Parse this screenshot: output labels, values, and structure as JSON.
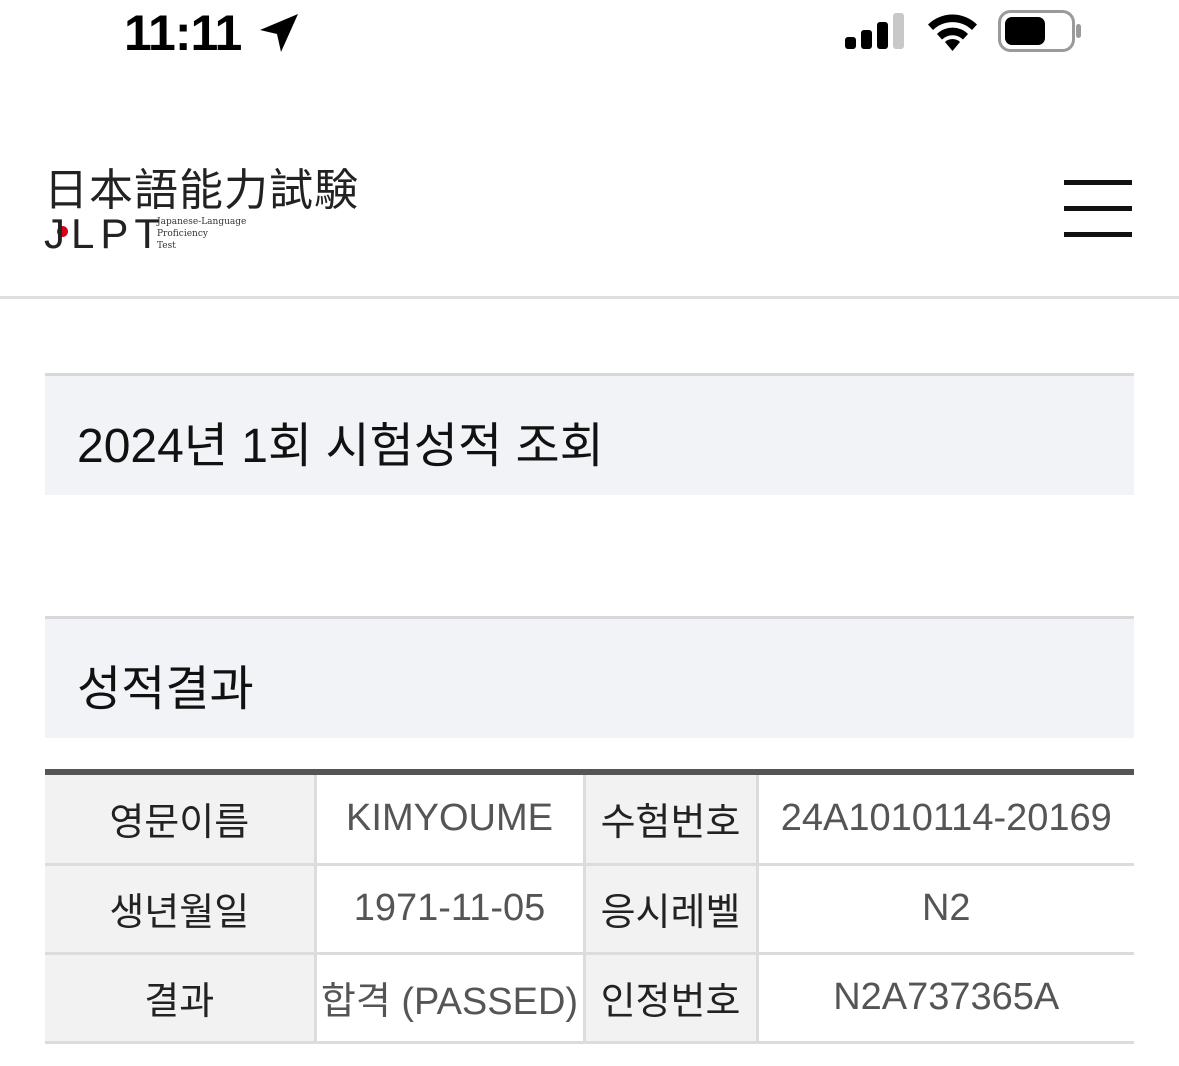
{
  "status_bar": {
    "time": "11:11",
    "icons": [
      "location-arrow-icon",
      "cellular-signal-icon",
      "wifi-icon",
      "battery-icon"
    ]
  },
  "header": {
    "logo_kanji": "日本語能力試験",
    "logo_abbr": "JLPT",
    "logo_sub_line1": "Japanese-Language",
    "logo_sub_line2": "Proficiency",
    "logo_sub_line3": "Test",
    "menu_icon": "hamburger-menu-icon"
  },
  "page": {
    "title": "2024년 1회 시험성적 조회",
    "section_title": "성적결과"
  },
  "results": {
    "rows": [
      {
        "label1": "영문이름",
        "value1": "KIMYOUME",
        "label2": "수험번호",
        "value2": "24A1010114-20169"
      },
      {
        "label1": "생년월일",
        "value1": "1971-11-05",
        "label2": "응시레벨",
        "value2": "N2"
      },
      {
        "label1": "결과",
        "value1": "합격 (PASSED)",
        "label2": "인정번호",
        "value2": "N2A737365A"
      }
    ]
  },
  "colors": {
    "brand_red": "#d4001a",
    "section_bg": "#f2f3f6",
    "table_label_bg": "#f2f2f2"
  }
}
